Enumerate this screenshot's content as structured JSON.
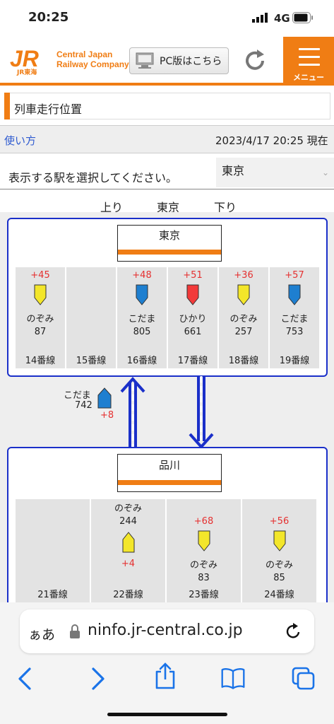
{
  "status_bar": {
    "time": "20:25",
    "network": "4G"
  },
  "header": {
    "logo_mark": "JR",
    "logo_sub": "JR東海",
    "company_line1": "Central Japan",
    "company_line2": "Railway Company",
    "pc_button": "PC版はこちら",
    "menu_label": "メニュー"
  },
  "page": {
    "title": "列車走行位置",
    "howto_link": "使い方",
    "datetime": "2023/4/17 20:25 現在",
    "select_prompt": "表示する駅を選択してください。",
    "selected_station": "東京"
  },
  "directions": {
    "up": "上り",
    "station": "東京",
    "down": "下り"
  },
  "stations": [
    {
      "name": "東京",
      "tracks": [
        {
          "track": "14番線",
          "delay": "+45",
          "train_name": "のぞみ",
          "train_no": "87",
          "type": "nozomi"
        },
        {
          "track": "15番線",
          "delay": "",
          "train_name": "",
          "train_no": "",
          "type": ""
        },
        {
          "track": "16番線",
          "delay": "+48",
          "train_name": "こだま",
          "train_no": "805",
          "type": "kodama"
        },
        {
          "track": "17番線",
          "delay": "+51",
          "train_name": "ひかり",
          "train_no": "661",
          "type": "hikari"
        },
        {
          "track": "18番線",
          "delay": "+36",
          "train_name": "のぞみ",
          "train_no": "257",
          "type": "nozomi"
        },
        {
          "track": "19番線",
          "delay": "+57",
          "train_name": "こだま",
          "train_no": "753",
          "type": "kodama"
        }
      ]
    },
    {
      "name": "品川",
      "tracks": [
        {
          "track": "21番線",
          "delay": "",
          "train_name": "",
          "train_no": "",
          "type": ""
        },
        {
          "track": "22番線",
          "delay": "+4",
          "train_name": "のぞみ",
          "train_no": "244",
          "type": "nozomi"
        },
        {
          "track": "23番線",
          "delay": "+68",
          "train_name": "のぞみ",
          "train_no": "83",
          "type": "nozomi"
        },
        {
          "track": "24番線",
          "delay": "+56",
          "train_name": "のぞみ",
          "train_no": "85",
          "type": "nozomi"
        }
      ]
    }
  ],
  "between_train": {
    "train_name": "こだま",
    "train_no": "742",
    "delay": "+8",
    "type": "kodama"
  },
  "colors": {
    "nozomi": "#f3e62a",
    "kodama": "#1e7fd0",
    "hikari": "#f23a3a",
    "accent": "#f07d14",
    "route": "#1a2fc9"
  },
  "browser": {
    "aa": "ぁあ",
    "url": "ninfo.jr-central.co.jp"
  },
  "icons": [
    "signal-icon",
    "battery-icon",
    "monitor-icon",
    "refresh-icon",
    "lock-icon",
    "reload-icon",
    "back-icon",
    "forward-icon",
    "share-icon",
    "bookmarks-icon",
    "tabs-icon"
  ]
}
